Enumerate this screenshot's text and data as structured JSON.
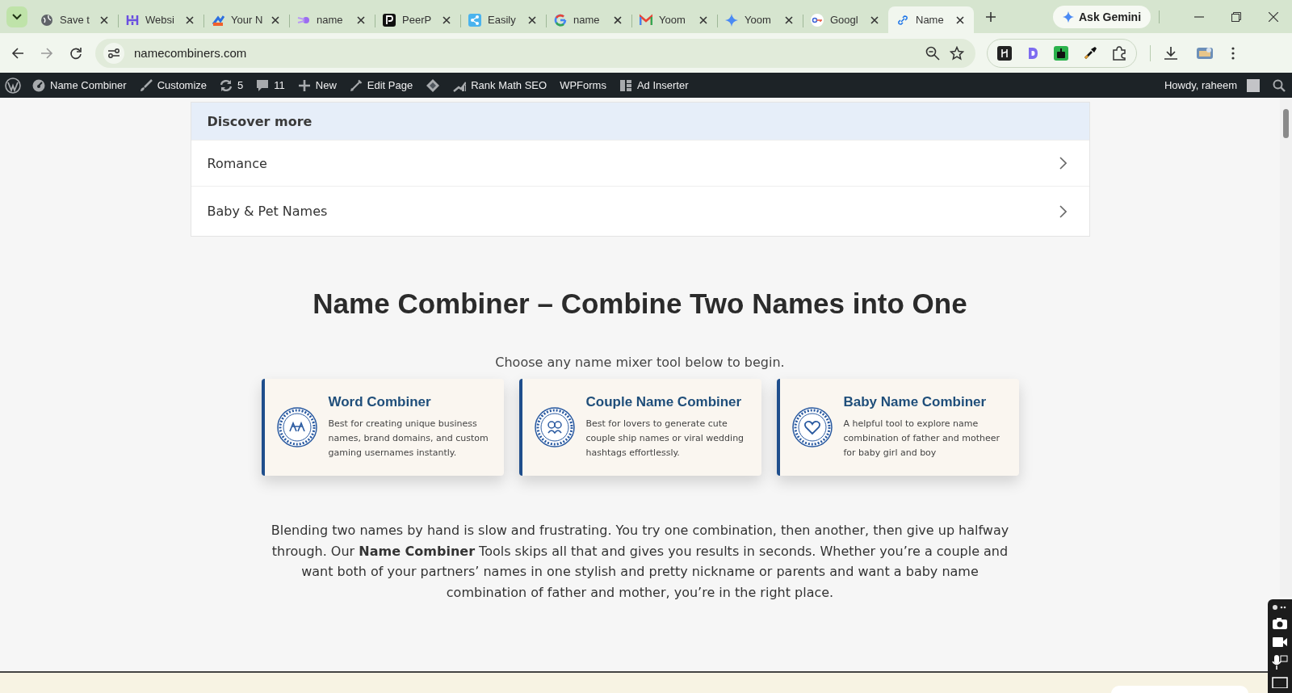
{
  "browser": {
    "tabs": [
      {
        "title": "Save t",
        "selected": false
      },
      {
        "title": "Websi",
        "selected": false
      },
      {
        "title": "Your N",
        "selected": false
      },
      {
        "title": "name",
        "selected": false
      },
      {
        "title": "PeerP",
        "selected": false
      },
      {
        "title": "Easily",
        "selected": false
      },
      {
        "title": "name",
        "selected": false
      },
      {
        "title": "Yoom",
        "selected": false
      },
      {
        "title": "Yoom",
        "selected": false
      },
      {
        "title": "Googl",
        "selected": false
      },
      {
        "title": "Name",
        "selected": true
      }
    ],
    "ask_button": "Ask Gemini",
    "url": "namecombiners.com"
  },
  "admin_bar": {
    "items": [
      {
        "kind": "site",
        "label": "Name Combiner"
      },
      {
        "kind": "customize",
        "label": "Customize"
      },
      {
        "kind": "updates",
        "label": "5"
      },
      {
        "kind": "comments",
        "label": "11"
      },
      {
        "kind": "new",
        "label": "New"
      },
      {
        "kind": "edit",
        "label": "Edit Page"
      },
      {
        "kind": "diamond"
      },
      {
        "kind": "rankmath",
        "label": "Rank Math SEO"
      },
      {
        "kind": "plain",
        "label": "WPForms"
      },
      {
        "kind": "adinserter",
        "label": "Ad Inserter"
      }
    ],
    "greeting": "Howdy, raheem"
  },
  "discover": {
    "title": "Discover more",
    "items": [
      "Romance",
      "Baby & Pet Names"
    ]
  },
  "heading": "Name Combiner – Combine Two Names into One",
  "subtitle": "Choose any name mixer tool below to begin.",
  "cards": [
    {
      "title": "Word Combiner",
      "text": "Best for creating unique business names, brand domains, and custom gaming usernames instantly."
    },
    {
      "title": "Couple Name Combiner",
      "text": "Best for lovers to generate cute couple ship names or viral wedding hashtags effortlessly."
    },
    {
      "title": "Baby Name Combiner",
      "text": "A helpful tool to explore name combination of father and motheer for baby girl and boy"
    }
  ],
  "intro": "Blending two names by hand is slow and frustrating. You try one combination, then another, then give up halfway through. Our **Name Combiner** Tools skips all that and gives you results in seconds. Whether you’re a couple and want both of your partners’ names in one stylish and pretty nickname or parents and want a baby name combination of father and mother, you’re in the right place."
}
